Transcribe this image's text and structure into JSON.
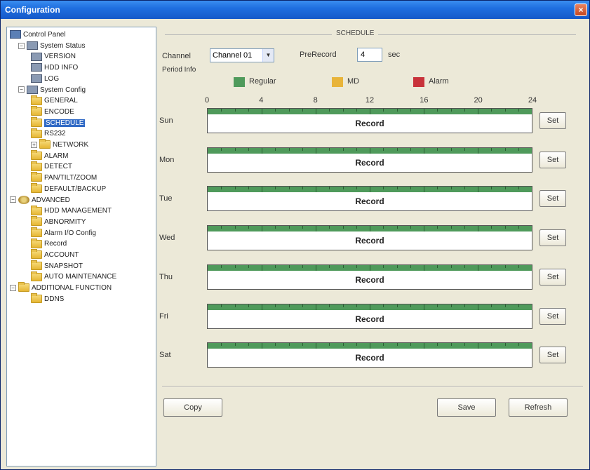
{
  "window": {
    "title": "Configuration",
    "close_glyph": "×"
  },
  "tree": [
    {
      "label": "Control Panel",
      "icon": "monitor-icon",
      "expander": "",
      "level": 0
    },
    {
      "label": "System Status",
      "icon": "pc-icon",
      "expander": "−",
      "level": 1
    },
    {
      "label": "VERSION",
      "icon": "pc-icon",
      "expander": "",
      "level": 2
    },
    {
      "label": "HDD INFO",
      "icon": "pc-icon",
      "expander": "",
      "level": 2
    },
    {
      "label": "LOG",
      "icon": "pc-icon",
      "expander": "",
      "level": 2
    },
    {
      "label": "System Config",
      "icon": "pc-icon",
      "expander": "−",
      "level": 1
    },
    {
      "label": "GENERAL",
      "icon": "folder-icon",
      "expander": "",
      "level": 2
    },
    {
      "label": "ENCODE",
      "icon": "folder-icon",
      "expander": "",
      "level": 2
    },
    {
      "label": "SCHEDULE",
      "icon": "folder-icon",
      "expander": "",
      "level": 2,
      "selected": true
    },
    {
      "label": "RS232",
      "icon": "folder-icon",
      "expander": "",
      "level": 2
    },
    {
      "label": "NETWORK",
      "icon": "folder-icon",
      "expander": "+",
      "level": 2
    },
    {
      "label": "ALARM",
      "icon": "folder-icon",
      "expander": "",
      "level": 2
    },
    {
      "label": "DETECT",
      "icon": "folder-icon",
      "expander": "",
      "level": 2
    },
    {
      "label": "PAN/TILT/ZOOM",
      "icon": "folder-icon",
      "expander": "",
      "level": 2
    },
    {
      "label": "DEFAULT/BACKUP",
      "icon": "folder-icon",
      "expander": "",
      "level": 2
    },
    {
      "label": "ADVANCED",
      "icon": "gear-icon",
      "expander": "−",
      "level": 0
    },
    {
      "label": "HDD MANAGEMENT",
      "icon": "folder-icon",
      "expander": "",
      "level": 2
    },
    {
      "label": "ABNORMITY",
      "icon": "folder-icon",
      "expander": "",
      "level": 2
    },
    {
      "label": "Alarm I/O Config",
      "icon": "folder-icon",
      "expander": "",
      "level": 2
    },
    {
      "label": "Record",
      "icon": "folder-icon",
      "expander": "",
      "level": 2
    },
    {
      "label": "ACCOUNT",
      "icon": "folder-icon",
      "expander": "",
      "level": 2
    },
    {
      "label": "SNAPSHOT",
      "icon": "folder-icon",
      "expander": "",
      "level": 2
    },
    {
      "label": "AUTO MAINTENANCE",
      "icon": "folder-icon",
      "expander": "",
      "level": 2
    },
    {
      "label": "ADDITIONAL FUNCTION",
      "icon": "folder-icon",
      "expander": "−",
      "level": 0
    },
    {
      "label": "DDNS",
      "icon": "folder-icon",
      "expander": "",
      "level": 2
    }
  ],
  "schedule": {
    "group_title": "SCHEDULE",
    "channel_label": "Channel",
    "channel_value": "Channel 01",
    "prerecord_label": "PreRecord",
    "prerecord_value": "4",
    "prerecord_unit": "sec",
    "period_info_label": "Period Info",
    "legend": [
      {
        "label": "Regular",
        "color": "#4f9a5b"
      },
      {
        "label": "MD",
        "color": "#e8b43a"
      },
      {
        "label": "Alarm",
        "color": "#c8323a"
      }
    ],
    "hours": [
      "0",
      "4",
      "8",
      "12",
      "16",
      "20",
      "24"
    ],
    "days": [
      {
        "label": "Sun",
        "bar_text": "Record",
        "set_label": "Set"
      },
      {
        "label": "Mon",
        "bar_text": "Record",
        "set_label": "Set"
      },
      {
        "label": "Tue",
        "bar_text": "Record",
        "set_label": "Set"
      },
      {
        "label": "Wed",
        "bar_text": "Record",
        "set_label": "Set"
      },
      {
        "label": "Thu",
        "bar_text": "Record",
        "set_label": "Set"
      },
      {
        "label": "Fri",
        "bar_text": "Record",
        "set_label": "Set"
      },
      {
        "label": "Sat",
        "bar_text": "Record",
        "set_label": "Set"
      }
    ],
    "copy_label": "Copy",
    "save_label": "Save",
    "refresh_label": "Refresh"
  }
}
